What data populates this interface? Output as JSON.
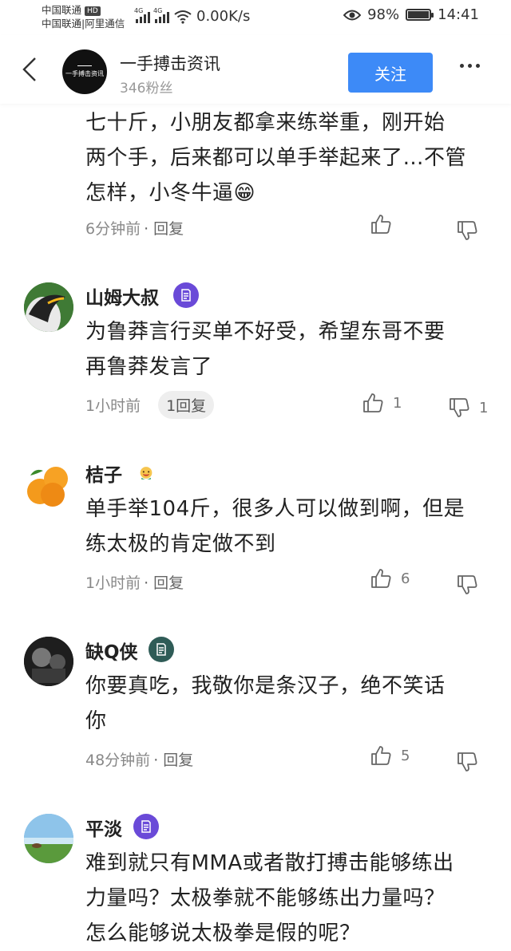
{
  "status_bar": {
    "carrier_1": "中国联通",
    "carrier_1_badge": "HD",
    "carrier_2": "中国联通|阿里通信",
    "net_type": "4G",
    "speed": "0.00K/s",
    "battery": "98%",
    "battery_level": 0.98,
    "time": "14:41"
  },
  "header": {
    "logo_text": "一手搏击资讯",
    "account_name": "一手搏击资讯",
    "fans": "346粉丝",
    "follow_label": "关注"
  },
  "comments": [
    {
      "text_lines": [
        "七十斤，小朋友都拿来练举重，刚开始",
        "两个手，后来都可以单手举起来了…不管",
        "怎样，小冬牛逼😁"
      ],
      "time": "6分钟前",
      "reply": "· 回复",
      "likes": "",
      "dislikes": ""
    },
    {
      "username": "山姆大叔",
      "text_lines": [
        "为鲁莽言行买单不好受，希望东哥不要",
        "再鲁莽发言了"
      ],
      "time": "1小时前",
      "reply": "1回复",
      "likes": "1",
      "dislikes": "1",
      "badge_color": "#6a4ad8"
    },
    {
      "username": "桔子",
      "text_lines": [
        "单手举104斤，很多人可以做到啊，但是",
        "练太极的肯定做不到"
      ],
      "time": "1小时前",
      "reply": "· 回复",
      "likes": "6",
      "dislikes": ""
    },
    {
      "username": "缺Q侠",
      "text_lines": [
        "你要真吃，我敬你是条汉子，绝不笑话",
        "你"
      ],
      "time": "48分钟前",
      "reply": "· 回复",
      "likes": "5",
      "dislikes": "",
      "badge_color": "#2f5c57"
    },
    {
      "username": "平淡",
      "text_lines": [
        "难到就只有MMA或者散打搏击能够练出",
        "力量吗？太极拳就不能够练出力量吗？",
        "怎么能够说太极拳是假的呢？"
      ],
      "badge_color": "#6a4ad8"
    }
  ]
}
